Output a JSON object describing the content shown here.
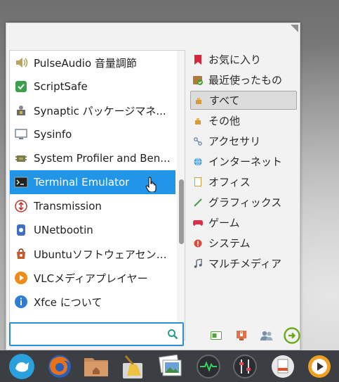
{
  "app_list": {
    "items": [
      {
        "label": "PulseAudio 音量調節",
        "icon": "speaker-icon"
      },
      {
        "label": "ScriptSafe",
        "icon": "scriptsafe-icon"
      },
      {
        "label": "Synaptic パッケージマネ...",
        "icon": "package-manager-icon"
      },
      {
        "label": "Sysinfo",
        "icon": "monitor-icon"
      },
      {
        "label": "System Profiler and Ben...",
        "icon": "profiler-icon"
      },
      {
        "label": "Terminal Emulator",
        "icon": "terminal-icon",
        "selected": true
      },
      {
        "label": "Transmission",
        "icon": "transmission-icon"
      },
      {
        "label": "UNetbootin",
        "icon": "unetbootin-icon"
      },
      {
        "label": "Ubuntuソフトウェアセンター",
        "icon": "software-center-icon"
      },
      {
        "label": "VLCメディアプレイヤー",
        "icon": "vlc-icon"
      },
      {
        "label": "Xfce について",
        "icon": "info-icon"
      }
    ]
  },
  "categories": {
    "items": [
      {
        "label": "お気に入り",
        "icon": "bookmark-icon"
      },
      {
        "label": "最近使ったもの",
        "icon": "recent-icon"
      },
      {
        "label": "すべて",
        "icon": "all-icon",
        "active": true
      },
      {
        "label": "その他",
        "icon": "other-icon"
      },
      {
        "label": "アクセサリ",
        "icon": "accessories-icon"
      },
      {
        "label": "インターネット",
        "icon": "internet-icon"
      },
      {
        "label": "オフィス",
        "icon": "office-icon"
      },
      {
        "label": "グラフィックス",
        "icon": "graphics-icon"
      },
      {
        "label": "ゲーム",
        "icon": "games-icon"
      },
      {
        "label": "システム",
        "icon": "system-icon"
      },
      {
        "label": "マルチメディア",
        "icon": "multimedia-icon"
      }
    ]
  },
  "search": {
    "value": "",
    "placeholder": ""
  },
  "actions": [
    "settings-manager-icon",
    "lock-screen-icon",
    "switch-user-icon",
    "log-out-icon"
  ],
  "dock": [
    "xfce-menu-icon",
    "firefox-icon",
    "home-folder-icon",
    "cleaner-icon",
    "photos-icon",
    "system-monitor-icon",
    "mixer-icon",
    "document-viewer-icon",
    "media-player-icon"
  ],
  "colors": {
    "selection": "#2196e8",
    "search_border": "#2b8fd6",
    "panel": "#3b3f44"
  }
}
